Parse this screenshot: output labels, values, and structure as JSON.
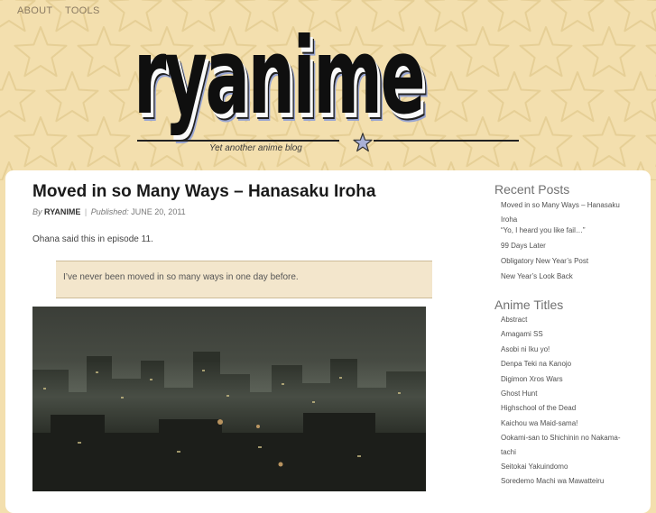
{
  "nav": {
    "about": "ABOUT",
    "tools": "TOOLS"
  },
  "header": {
    "logo": "ryanime",
    "tagline": "Yet another anime blog"
  },
  "post": {
    "title": "Moved in so Many Ways – Hanasaku Iroha",
    "by_label": "By",
    "author": "RYANIME",
    "separator": "|",
    "published_label": "Published:",
    "date": "JUNE 20, 2011",
    "intro": "Ohana said this in episode 11.",
    "quote": "I’ve never been moved in so many ways in one day before."
  },
  "sidebar": {
    "recent_heading": "Recent Posts",
    "recent": [
      "Moved in so Many Ways – Hanasaku Iroha",
      "“Yo, I heard you like fail…”",
      "99 Days Later",
      "Obligatory New Year’s Post",
      "New Year’s Look Back"
    ],
    "anime_heading": "Anime Titles",
    "anime": [
      "Abstract",
      "Amagami SS",
      "Asobi ni Iku yo!",
      "Denpa Teki na Kanojo",
      "Digimon Xros Wars",
      "Ghost Hunt",
      "Highschool of the Dead",
      "Kaichou wa Maid-sama!",
      "Ookami-san to Shichinin no Nakama-tachi",
      "Seitokai Yakuindomo",
      "Soredemo Machi wa Mawatteiru"
    ]
  },
  "colors": {
    "background": "#f3dfae",
    "panel": "#ffffff",
    "quote_bg": "#f3e6cc",
    "star_icon": "#a9b1d8"
  },
  "icons": {
    "header_star": "star-icon"
  }
}
